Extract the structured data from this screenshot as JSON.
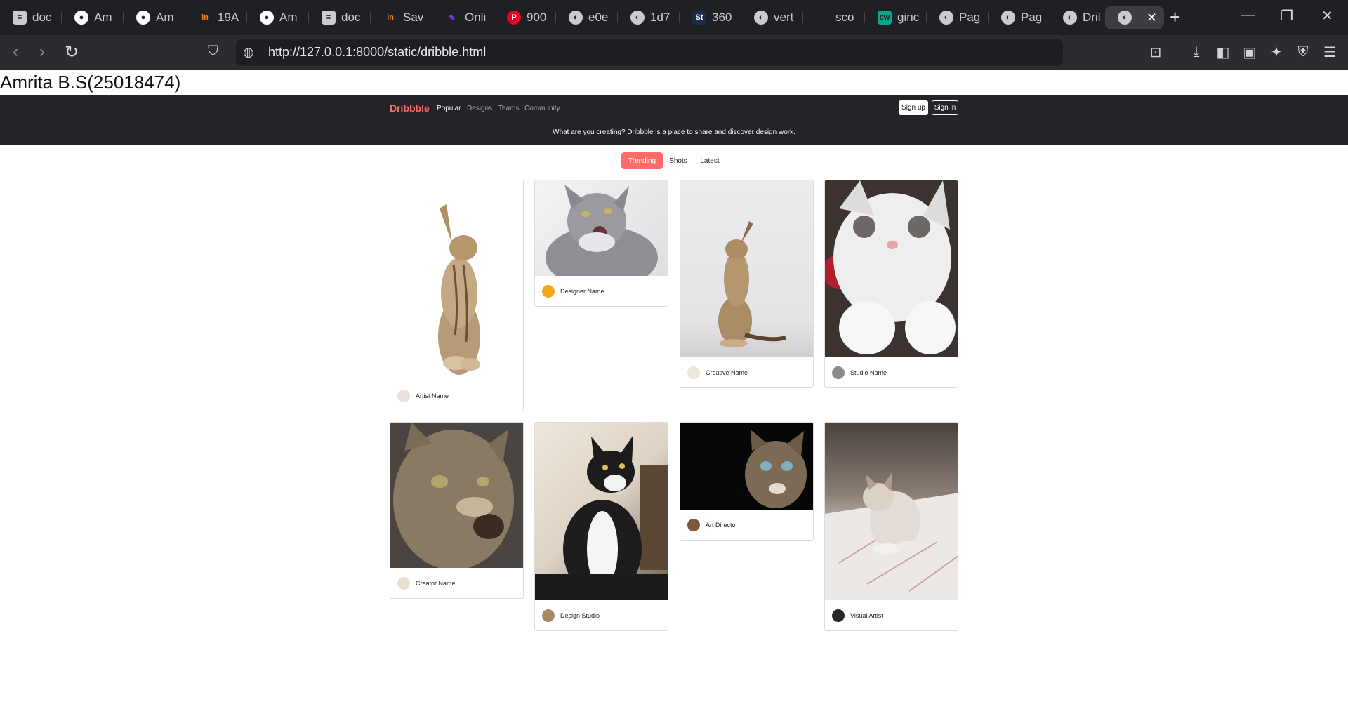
{
  "browser": {
    "tabs": [
      {
        "label": "doc",
        "icon": "document-icon",
        "color": "#c9cbd0"
      },
      {
        "label": "Am",
        "icon": "github-icon",
        "color": "#ffffff"
      },
      {
        "label": "Am",
        "icon": "github-icon",
        "color": "#ffffff"
      },
      {
        "label": "19A",
        "icon": "in-icon",
        "color": "#f57f20"
      },
      {
        "label": "Am",
        "icon": "github-icon",
        "color": "#ffffff"
      },
      {
        "label": "doc",
        "icon": "document-icon",
        "color": "#c9cbd0"
      },
      {
        "label": "Sav",
        "icon": "in-icon",
        "color": "#f57f20"
      },
      {
        "label": "Onli",
        "icon": "pen-icon",
        "color": "#7b3ff2"
      },
      {
        "label": "900",
        "icon": "pinterest-icon",
        "color": "#e60023"
      },
      {
        "label": "e0e",
        "icon": "globe-icon",
        "color": "#c9cbd0"
      },
      {
        "label": "1d7",
        "icon": "globe-icon",
        "color": "#c9cbd0"
      },
      {
        "label": "360",
        "icon": "st-icon",
        "color": "#ffffff"
      },
      {
        "label": "vert",
        "icon": "globe-icon",
        "color": "#c9cbd0"
      },
      {
        "label": "sco",
        "icon": "blank-icon",
        "color": "#c9cbd0"
      },
      {
        "label": "ginc",
        "icon": "cw-icon",
        "color": "#00a88f"
      },
      {
        "label": "Pag",
        "icon": "globe-icon",
        "color": "#c9cbd0"
      },
      {
        "label": "Pag",
        "icon": "globe-icon",
        "color": "#c9cbd0"
      },
      {
        "label": "Dril",
        "icon": "globe-icon",
        "color": "#c9cbd0"
      }
    ],
    "active_tab_icon": "globe-icon",
    "url": "http://127.0.0.1:8000/static/dribble.html"
  },
  "student_name": "Amrita B.S(25018474)",
  "site": {
    "logo": "Dribbble",
    "nav": [
      "Popular",
      "Designs",
      "Teams",
      "Community"
    ],
    "signup": "Sign up",
    "signin": "Sign in",
    "tagline": "What are you creating? Dribbble is a place to share and discover design work.",
    "filters": [
      "Trending",
      "Shots",
      "Latest"
    ],
    "accent": "#ff6b6b"
  },
  "cards": [
    {
      "name": "Artist Name"
    },
    {
      "name": "Designer Name"
    },
    {
      "name": "Creative Name"
    },
    {
      "name": "Studio Name"
    },
    {
      "name": "Creator Name"
    },
    {
      "name": "Design Studio"
    },
    {
      "name": "Art Director"
    },
    {
      "name": "Visual Artist"
    }
  ]
}
